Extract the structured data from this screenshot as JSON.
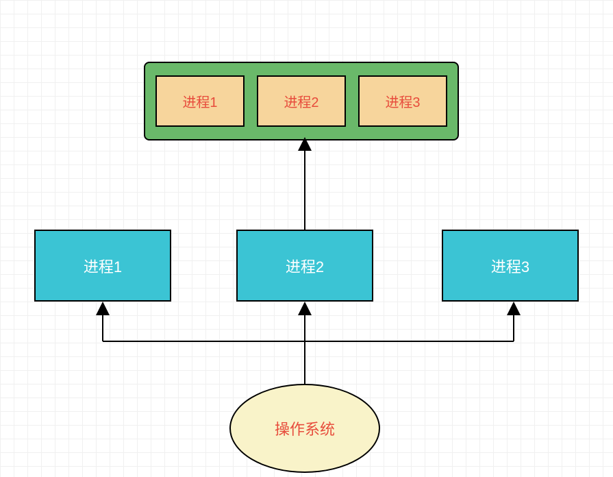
{
  "container": {
    "processes": [
      "进程1",
      "进程2",
      "进程3"
    ]
  },
  "middleRow": {
    "process1": "进程1",
    "process2": "进程2",
    "process3": "进程3"
  },
  "os": {
    "label": "操作系统"
  },
  "colors": {
    "containerBg": "#6ab96a",
    "innerProcessBg": "#f7d59c",
    "processBg": "#3bc4d4",
    "ellipseBg": "#f9f3c9",
    "redText": "#e74c3c",
    "whiteText": "#ffffff",
    "border": "#000000"
  }
}
